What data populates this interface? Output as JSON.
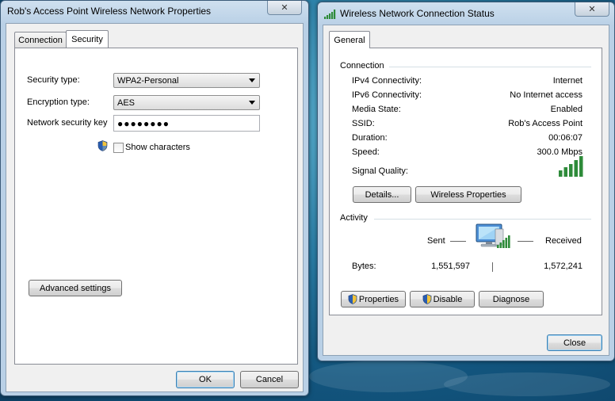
{
  "left_window": {
    "title": "Rob's Access Point Wireless Network Properties",
    "close_label": "✕",
    "tabs": [
      "Connection",
      "Security"
    ],
    "active_tab": "Security",
    "security_type_label": "Security type:",
    "security_type_value": "WPA2-Personal",
    "encryption_type_label": "Encryption type:",
    "encryption_type_value": "AES",
    "key_label": "Network security key",
    "key_value": "●●●●●●●●",
    "show_characters_label": "Show characters",
    "advanced_button": "Advanced settings",
    "ok_button": "OK",
    "cancel_button": "Cancel"
  },
  "right_window": {
    "title": "Wireless Network Connection Status",
    "close_label": "✕",
    "tab": "General",
    "connection_heading": "Connection",
    "rows": [
      {
        "label": "IPv4 Connectivity:",
        "value": "Internet"
      },
      {
        "label": "IPv6 Connectivity:",
        "value": "No Internet access"
      },
      {
        "label": "Media State:",
        "value": "Enabled"
      },
      {
        "label": "SSID:",
        "value": "Rob's Access Point"
      },
      {
        "label": "Duration:",
        "value": "00:06:07"
      },
      {
        "label": "Speed:",
        "value": "300.0 Mbps"
      }
    ],
    "signal_quality_label": "Signal Quality:",
    "details_button": "Details...",
    "wireless_properties_button": "Wireless Properties",
    "activity_heading": "Activity",
    "sent_label": "Sent",
    "received_label": "Received",
    "bytes_label": "Bytes:",
    "bytes_sent": "1,551,597",
    "bytes_received": "1,572,241",
    "properties_button": "Properties",
    "disable_button": "Disable",
    "diagnose_button": "Diagnose",
    "close_button": "Close"
  },
  "icons": {
    "signal": "signal-bars-icon",
    "shield": "uac-shield-icon",
    "network": "network-computer-icon"
  },
  "colors": {
    "signal_green": "#2e8b3a",
    "desktop_blue": "#2a7fa8"
  }
}
